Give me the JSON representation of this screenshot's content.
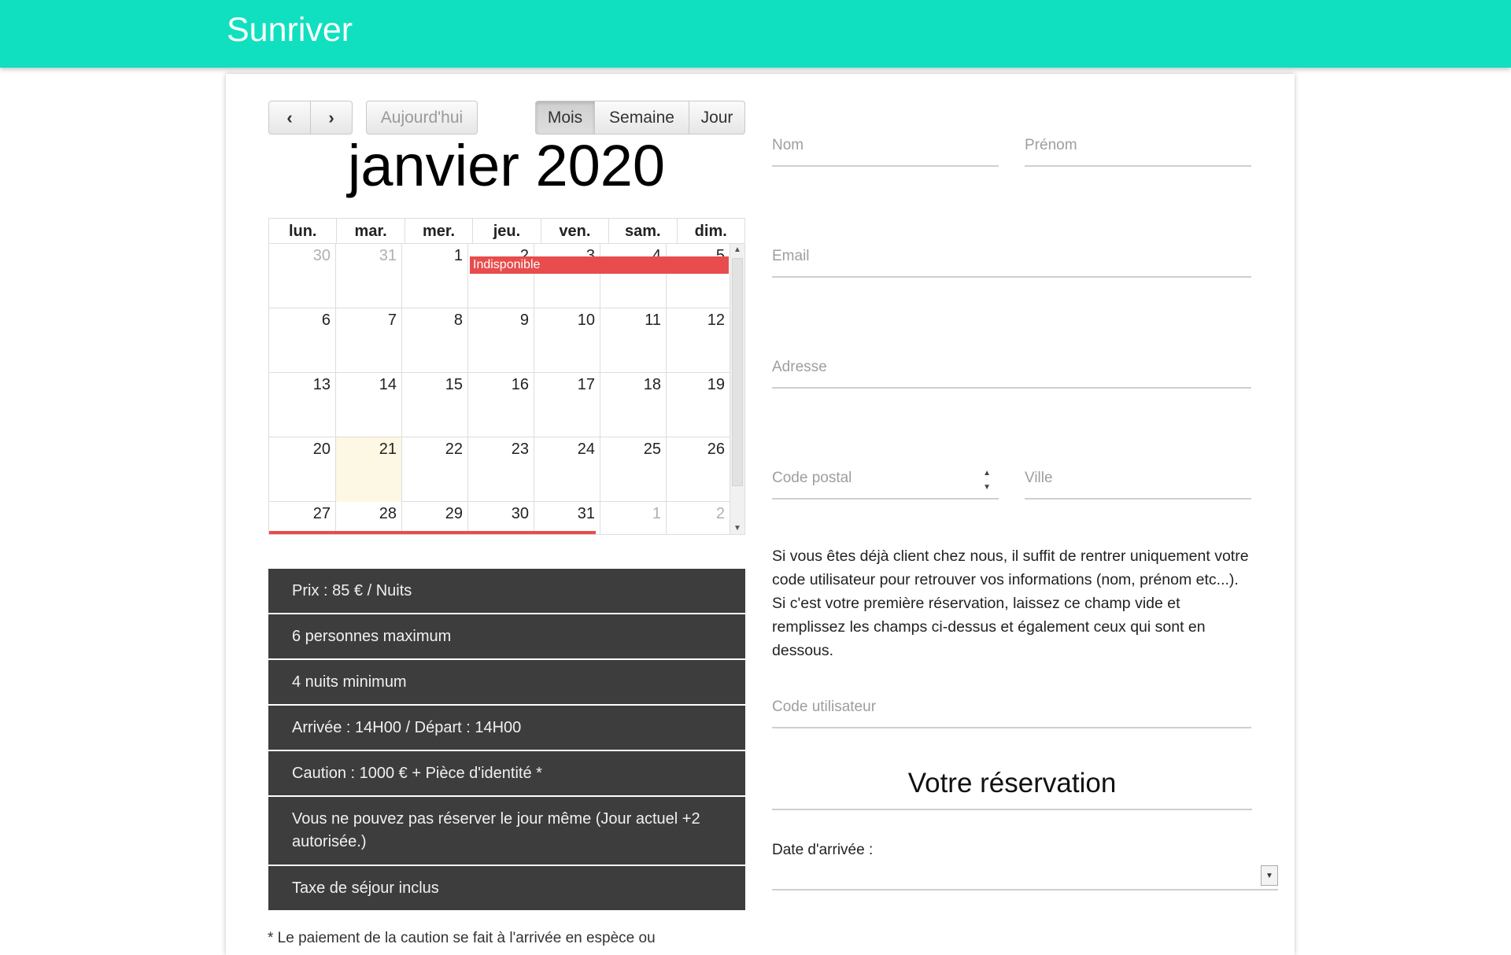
{
  "header": {
    "brand": "Sunriver",
    "bg_color": "#10e0c0"
  },
  "toolbar": {
    "prev_icon": "chevron-left-icon",
    "next_icon": "chevron-right-icon",
    "today_label": "Aujourd'hui",
    "views": [
      "Mois",
      "Semaine",
      "Jour"
    ],
    "active_view": "Mois"
  },
  "calendar": {
    "title": "janvier 2020",
    "weekday_headers": [
      "lun.",
      "mar.",
      "mer.",
      "jeu.",
      "ven.",
      "sam.",
      "dim."
    ],
    "weeks": [
      [
        "30",
        "31",
        "1",
        "2",
        "3",
        "4",
        "5"
      ],
      [
        "6",
        "7",
        "8",
        "9",
        "10",
        "11",
        "12"
      ],
      [
        "13",
        "14",
        "15",
        "16",
        "17",
        "18",
        "19"
      ],
      [
        "20",
        "21",
        "22",
        "23",
        "24",
        "25",
        "26"
      ],
      [
        "27",
        "28",
        "29",
        "30",
        "31",
        "1",
        "2"
      ]
    ],
    "today": "21",
    "event_label": "Indisponible",
    "event_color": "#e84c4c"
  },
  "info_items": [
    "Prix : 85 € / Nuits",
    "6 personnes maximum",
    "4 nuits minimum",
    "Arrivée : 14H00 / Départ : 14H00",
    "Caution : 1000 € + Pièce d'identité *",
    "Vous ne pouvez pas réserver le jour même (Jour actuel +2 autorisée.)",
    "Taxe de séjour inclus"
  ],
  "footnote": "* Le paiement de la caution se fait à l'arrivée en espèce ou",
  "form": {
    "nom_placeholder": "Nom",
    "prenom_placeholder": "Prénom",
    "email_placeholder": "Email",
    "adresse_placeholder": "Adresse",
    "code_postal_placeholder": "Code postal",
    "ville_placeholder": "Ville",
    "info_paragraph": "Si vous êtes déjà client chez nous, il suffit de rentrer uniquement votre code utilisateur pour retrouver vos informations (nom, prénom etc...). Si c'est votre première réservation, laissez ce champ vide et remplissez les champs ci-dessus et également ceux qui sont en dessous.",
    "code_utilisateur_placeholder": "Code utilisateur",
    "reservation_title": "Votre réservation",
    "date_arrivee_label": "Date d'arrivée :"
  }
}
